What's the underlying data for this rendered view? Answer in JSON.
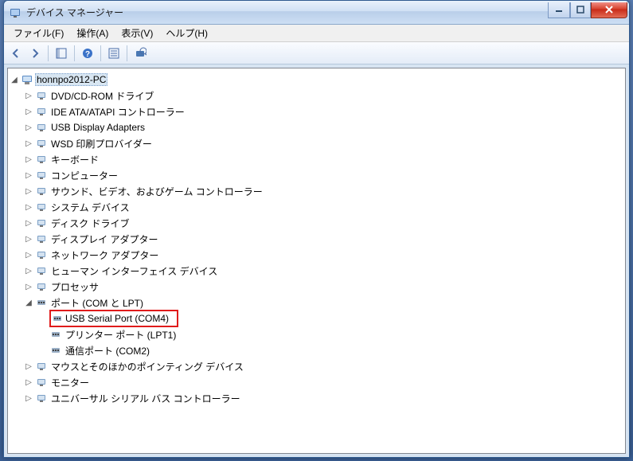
{
  "window": {
    "title": "デバイス マネージャー"
  },
  "menu": {
    "file": "ファイル(F)",
    "action": "操作(A)",
    "view": "表示(V)",
    "help": "ヘルプ(H)"
  },
  "tree": {
    "root": "honnpo2012-PC",
    "items": [
      "DVD/CD-ROM ドライブ",
      "IDE ATA/ATAPI コントローラー",
      "USB Display Adapters",
      "WSD 印刷プロバイダー",
      "キーボード",
      "コンピューター",
      "サウンド、ビデオ、およびゲーム コントローラー",
      "システム デバイス",
      "ディスク ドライブ",
      "ディスプレイ アダプター",
      "ネットワーク アダプター",
      "ヒューマン インターフェイス デバイス",
      "プロセッサ"
    ],
    "ports_label": "ポート (COM と LPT)",
    "ports_children": [
      "USB Serial Port (COM4)",
      "プリンター ポート (LPT1)",
      "通信ポート (COM2)"
    ],
    "items_after": [
      "マウスとそのほかのポインティング デバイス",
      "モニター",
      "ユニバーサル シリアル バス コントローラー"
    ]
  }
}
